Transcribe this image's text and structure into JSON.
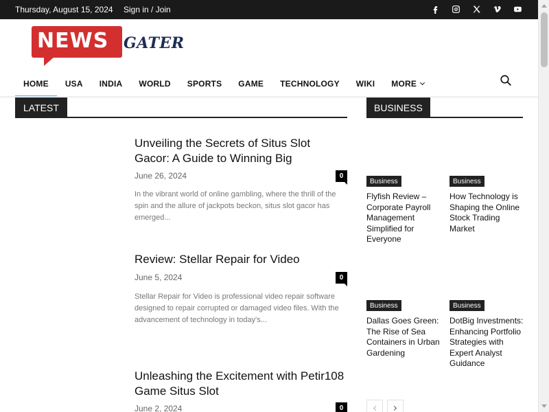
{
  "topbar": {
    "date": "Thursday, August 15, 2024",
    "signin_label": "Sign in / Join",
    "social": [
      "facebook-icon",
      "instagram-icon",
      "x-icon",
      "vimeo-icon",
      "youtube-icon"
    ]
  },
  "logo": {
    "part1": "NEWS",
    "part2": "GATER"
  },
  "nav": {
    "items": [
      "HOME",
      "USA",
      "INDIA",
      "WORLD",
      "SPORTS",
      "GAME",
      "TECHNOLOGY",
      "WIKI",
      "MORE"
    ],
    "active": "HOME"
  },
  "latest": {
    "heading": "LATEST",
    "articles": [
      {
        "title": "Unveiling the Secrets of Situs Slot Gacor: A Guide to Winning Big",
        "date": "June 26, 2024",
        "comments": "0",
        "excerpt": "In the vibrant world of online gambling, where the thrill of the spin and the allure of jackpots beckon, situs slot gacor has emerged..."
      },
      {
        "title": "Review: Stellar Repair for Video",
        "date": "June 5, 2024",
        "comments": "0",
        "excerpt": "Stellar Repair for Video is professional video repair software designed to repair corrupted or damaged video files. With the advancement of technology in today's..."
      },
      {
        "title": "Unleashing the Excitement with Petir108 Game Situs Slot",
        "date": "June 2, 2024",
        "comments": "0"
      }
    ]
  },
  "business": {
    "heading": "BUSINESS",
    "cards": [
      {
        "category": "Business",
        "title": "Flyfish Review – Corporate Payroll Management Simplified for Everyone"
      },
      {
        "category": "Business",
        "title": "How Technology is Shaping the Online Stock Trading Market"
      },
      {
        "category": "Business",
        "title": "Dallas Goes Green: The Rise of Sea Containers in Urban Gardening"
      },
      {
        "category": "Business",
        "title": "DotBig Investments: Enhancing Portfolio Strategies with Expert Analyst Guidance"
      }
    ]
  },
  "colors": {
    "topbar_bg": "#1a1a1a",
    "logo_red": "#d32f2f",
    "logo_navy": "#1e2d52",
    "accent_blue": "#4db2ec"
  }
}
